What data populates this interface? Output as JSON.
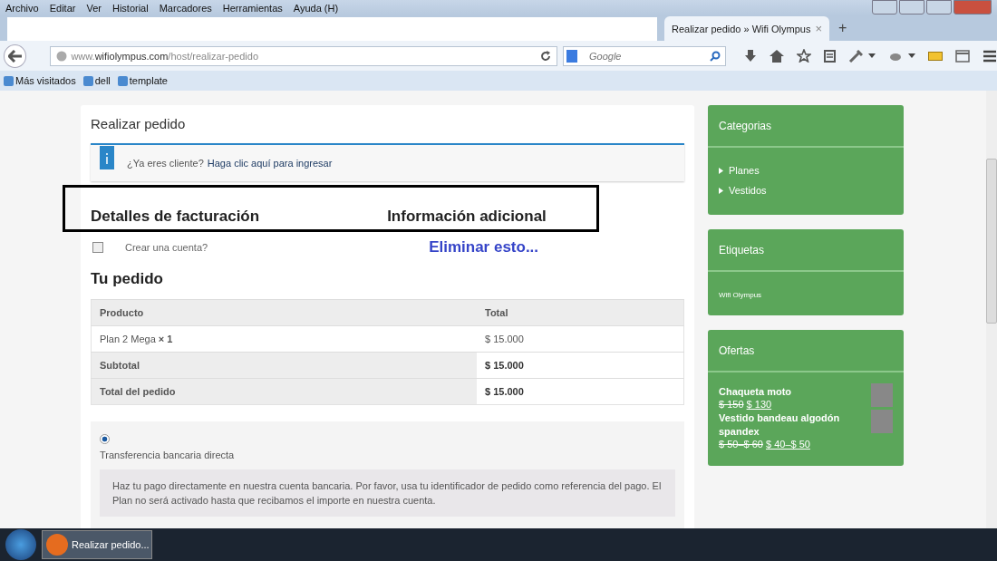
{
  "menu_bar": [
    "Archivo",
    "Editar",
    "Ver",
    "Historial",
    "Marcadores",
    "Herramientas",
    "Ayuda (H)"
  ],
  "tab": {
    "title": "Realizar pedido » Wifi Olympus",
    "close": "×",
    "new_tab": "+",
    "selected": true
  },
  "address_bar": {
    "prefix": "www.",
    "domain": "wifiolympus.com",
    "path": "/host/realizar-pedido"
  },
  "search": {
    "placeholder": "Google"
  },
  "bookmarks": [
    "Más visitados",
    "dell",
    "template"
  ],
  "page": {
    "title": "Realizar pedido",
    "notice": {
      "text": "¿Ya eres cliente?",
      "link": "Haga clic aquí para ingresar"
    },
    "headings": [
      "Detalles de facturación",
      "Información adicional"
    ],
    "annotation": "Eliminar esto...",
    "create_account": {
      "label": "Crear una cuenta?",
      "checked": false
    },
    "order_title": "Tu pedido",
    "table": {
      "columns": [
        "Producto",
        "Total"
      ],
      "rows": [
        {
          "kind": "item",
          "label": "Plan 2 Mega **× 1**",
          "value": "$ 15.000"
        },
        {
          "kind": "subtotal",
          "label": "Subtotal",
          "value": "$ 15.000"
        },
        {
          "kind": "total",
          "label": "Total del pedido",
          "value": "$ 15.000"
        }
      ]
    },
    "payment": {
      "selected": true,
      "label": "Transferencia bancaria directa",
      "description": "Haz tu pago directamente en nuestra cuenta bancaria. Por favor, usa tu identificador de pedido como referencia del pago. El Plan no será activado hasta que recibamos el importe en nuestra cuenta."
    }
  },
  "sidebar": [
    {
      "kind": "list",
      "title": "Categorias",
      "items": [
        "Planes",
        "Vestidos"
      ]
    },
    {
      "kind": "tags",
      "title": "Etiquetas",
      "items": [
        "Wifi Olympus"
      ]
    },
    {
      "kind": "offers",
      "title": "Ofertas",
      "products": [
        {
          "name": "Chaqueta moto",
          "old_price": "$ 150",
          "new_price": "$ 130"
        },
        {
          "name": "Vestido bandeau algodón spandex",
          "old_price": "$ 50–$ 60",
          "new_price": "$ 40–$ 50"
        }
      ]
    }
  ],
  "taskbar": {
    "window": "Realizar pedido..."
  }
}
